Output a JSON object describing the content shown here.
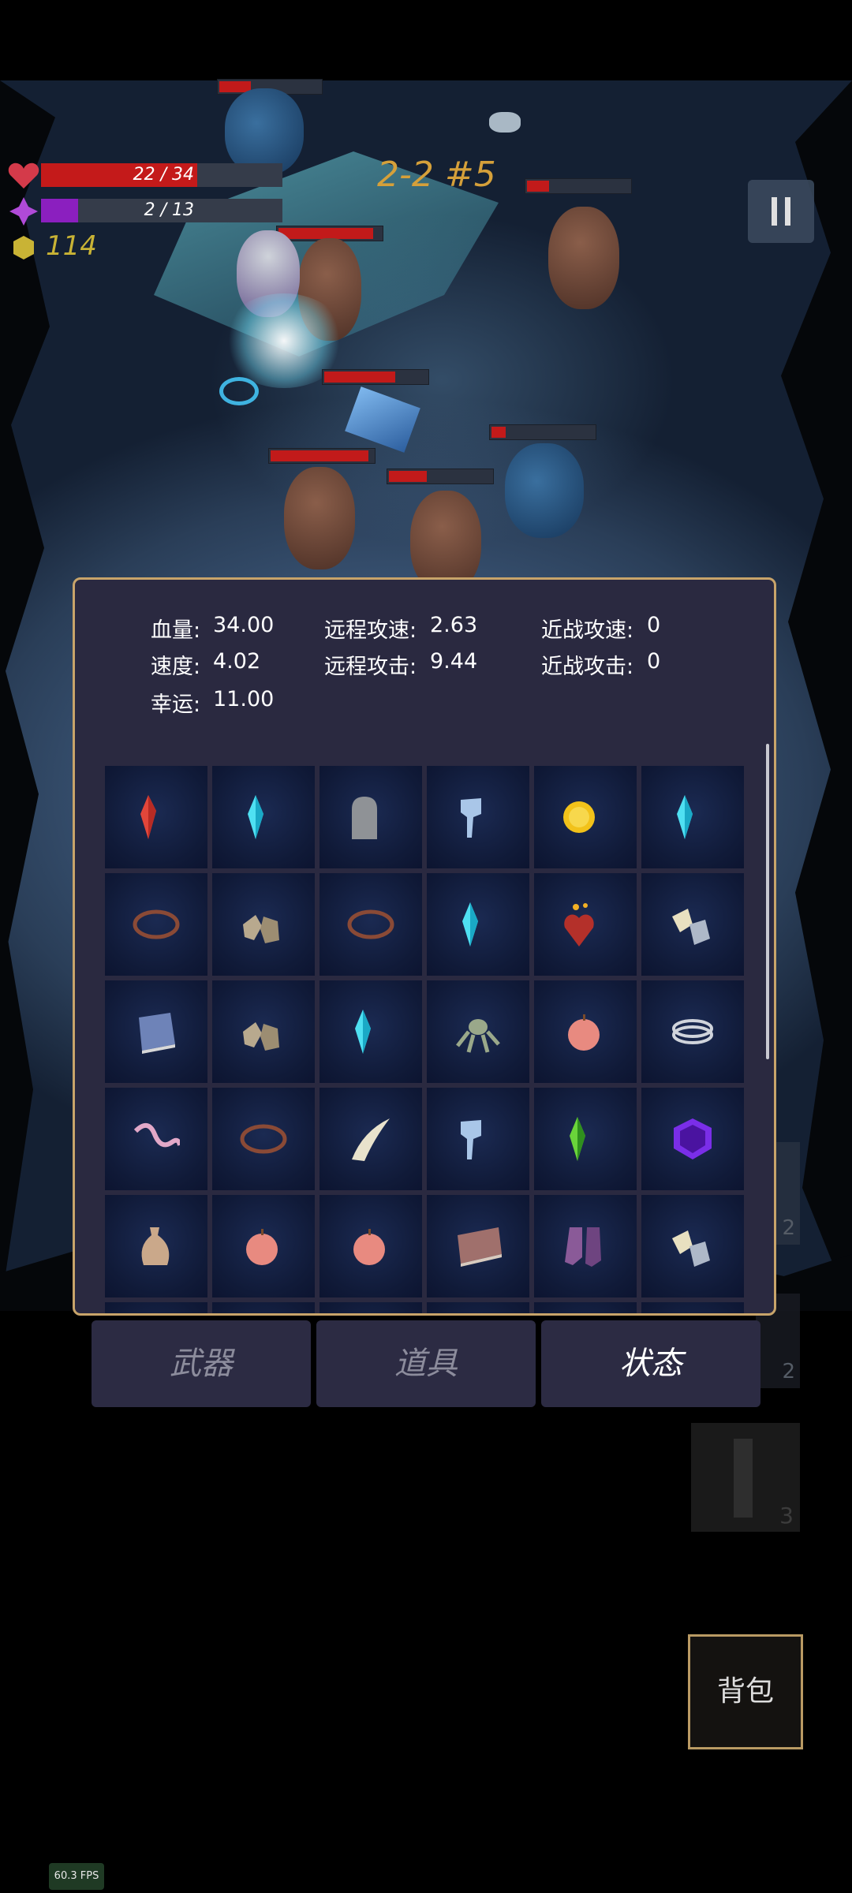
{
  "hud": {
    "hp_text": "22 / 34",
    "hp_fraction": 0.647,
    "mp_text": "2 / 13",
    "mp_fraction": 0.154,
    "coins": "114",
    "wave": "2-2 #5",
    "pause_icon": "pause-icon",
    "colors": {
      "hp": "#c41a1a",
      "mp": "#8b1fbf",
      "coin": "#c9b335",
      "wave": "#d5a03a"
    }
  },
  "stats": {
    "hp_label": "血量:",
    "hp_value": "34.00",
    "speed_label": "速度:",
    "speed_value": "4.02",
    "luck_label": "幸运:",
    "luck_value": "11.00",
    "ranged_speed_label": "远程攻速:",
    "ranged_speed_value": "2.63",
    "ranged_attack_label": "远程攻击:",
    "ranged_attack_value": "9.44",
    "melee_speed_label": "近战攻速:",
    "melee_speed_value": "0",
    "melee_attack_label": "近战攻击:",
    "melee_attack_value": "0"
  },
  "inventory": [
    [
      "red-crystal-icon",
      "cyan-crystal-icon",
      "tombstone-icon",
      "blue-mask-icon",
      "gold-coin-icon",
      "cyan-crystal-icon"
    ],
    [
      "thorn-ring-icon",
      "rock-pile-icon",
      "thorn-ring-icon",
      "cyan-crystal-icon",
      "burning-heart-icon",
      "ore-chunks-icon"
    ],
    [
      "blue-book-icon",
      "rock-pile-icon",
      "cyan-crystal-icon",
      "octopus-icon",
      "peach-icon",
      "silver-rings-icon"
    ],
    [
      "pink-worm-icon",
      "thorn-ring-icon",
      "fang-icon",
      "blue-mask-icon",
      "green-crystal-icon",
      "purple-gem-icon"
    ],
    [
      "pouch-icon",
      "peach-icon",
      "peach-icon",
      "brown-book-icon",
      "purple-boots-icon",
      "ore-chunks-icon"
    ]
  ],
  "tabs": [
    {
      "label": "武器",
      "active": false
    },
    {
      "label": "道具",
      "active": false
    },
    {
      "label": "状态",
      "active": true
    }
  ],
  "side_slots": [
    "2",
    "2",
    "3"
  ],
  "bag_label": "背包",
  "fps": "60.3 FPS"
}
